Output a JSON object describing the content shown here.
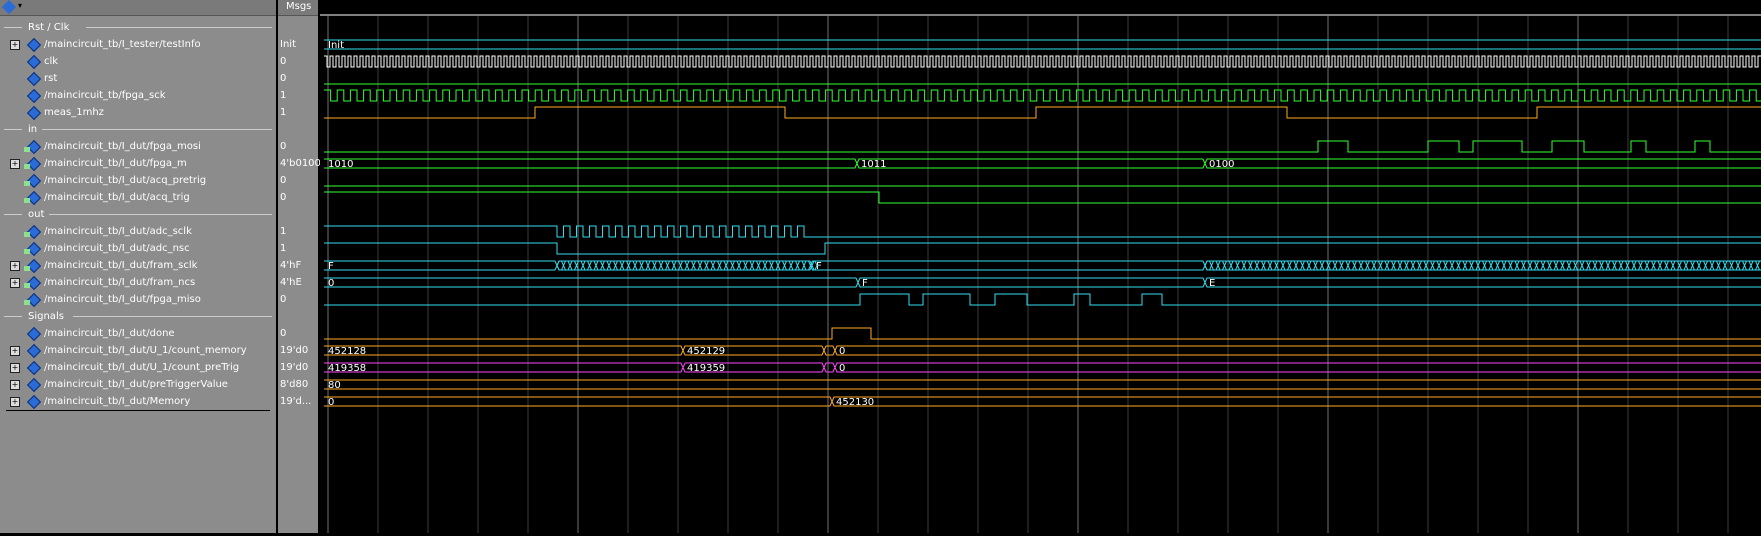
{
  "header": {
    "msgs_label": "Msgs"
  },
  "colors": {
    "clk": "#ffffff",
    "fpga_sck": "#33ff33",
    "meas": "#ffaa22",
    "green": "#33ff33",
    "cyan": "#33ddee",
    "orange": "#ffaa22",
    "magenta": "#ff44ff",
    "grid": "#404040",
    "gridStrong": "#888888"
  },
  "groups": [
    {
      "id": "rst-clk",
      "label": "Rst / Clk"
    },
    {
      "id": "in",
      "label": "in"
    },
    {
      "id": "out",
      "label": "out"
    },
    {
      "id": "signals",
      "label": "Signals"
    }
  ],
  "signals": [
    {
      "id": "testInfo",
      "name": "/maincircuit_tb/I_tester/testInfo",
      "msg": "Init",
      "expand": true,
      "io": ""
    },
    {
      "id": "clk",
      "name": "clk",
      "msg": "0",
      "expand": false,
      "io": ""
    },
    {
      "id": "rst",
      "name": "rst",
      "msg": "0",
      "expand": false,
      "io": ""
    },
    {
      "id": "fpga_sck",
      "name": "/maincircuit_tb/fpga_sck",
      "msg": "1",
      "expand": false,
      "io": ""
    },
    {
      "id": "meas_1mhz",
      "name": "meas_1mhz",
      "msg": "1",
      "expand": false,
      "io": ""
    },
    {
      "id": "fpga_mosi",
      "name": "/maincircuit_tb/I_dut/fpga_mosi",
      "msg": "0",
      "expand": false,
      "io": "in"
    },
    {
      "id": "fpga_m",
      "name": "/maincircuit_tb/I_dut/fpga_m",
      "msg": "4'b0100",
      "expand": true,
      "io": "in"
    },
    {
      "id": "acq_pretrig",
      "name": "/maincircuit_tb/I_dut/acq_pretrig",
      "msg": "0",
      "expand": false,
      "io": "in"
    },
    {
      "id": "acq_trig",
      "name": "/maincircuit_tb/I_dut/acq_trig",
      "msg": "0",
      "expand": false,
      "io": "in"
    },
    {
      "id": "adc_sclk",
      "name": "/maincircuit_tb/I_dut/adc_sclk",
      "msg": "1",
      "expand": false,
      "io": "out"
    },
    {
      "id": "adc_nsc",
      "name": "/maincircuit_tb/I_dut/adc_nsc",
      "msg": "1",
      "expand": false,
      "io": "out"
    },
    {
      "id": "fram_sclk",
      "name": "/maincircuit_tb/I_dut/fram_sclk",
      "msg": "4'hF",
      "expand": true,
      "io": "out"
    },
    {
      "id": "fram_ncs",
      "name": "/maincircuit_tb/I_dut/fram_ncs",
      "msg": "4'hE",
      "expand": true,
      "io": "out"
    },
    {
      "id": "fpga_miso",
      "name": "/maincircuit_tb/I_dut/fpga_miso",
      "msg": "0",
      "expand": false,
      "io": "out"
    },
    {
      "id": "done",
      "name": "/maincircuit_tb/I_dut/done",
      "msg": "0",
      "expand": false,
      "io": ""
    },
    {
      "id": "count_memory",
      "name": "/maincircuit_tb/I_dut/U_1/count_memory",
      "msg": "19'd0",
      "expand": true,
      "io": ""
    },
    {
      "id": "count_preTrig",
      "name": "/maincircuit_tb/I_dut/U_1/count_preTrig",
      "msg": "19'd0",
      "expand": true,
      "io": ""
    },
    {
      "id": "preTriggerValue",
      "name": "/maincircuit_tb/I_dut/preTriggerValue",
      "msg": "8'd80",
      "expand": true,
      "io": ""
    },
    {
      "id": "memory",
      "name": "/maincircuit_tb/I_dut/Memory",
      "msg": "19'd...",
      "expand": true,
      "io": ""
    }
  ],
  "wave_labels": {
    "testInfo": [
      "Init"
    ],
    "fpga_m": [
      "1010",
      "1011",
      "0100"
    ],
    "fram_sclk": [
      "F",
      "F"
    ],
    "fram_ncs": [
      "0",
      "F",
      "E"
    ],
    "count_memory": [
      "452128",
      "452129",
      "0"
    ],
    "count_preTrig": [
      "419358",
      "419359",
      "0"
    ],
    "preTriggerValue": [
      "80"
    ],
    "memory": [
      "0",
      "452130"
    ]
  }
}
